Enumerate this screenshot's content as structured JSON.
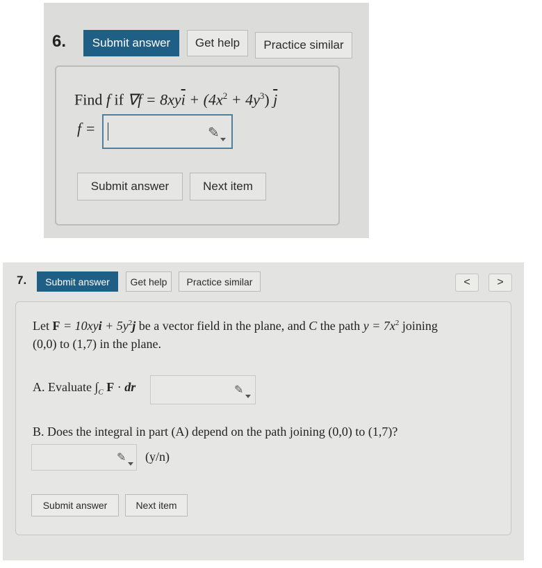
{
  "q6": {
    "number": "6.",
    "submit_top": "Submit answer",
    "get_help": "Get help",
    "practice_similar": "Practice similar",
    "prompt_find": "Find",
    "prompt_f": "f",
    "prompt_if": "if",
    "prompt_grad": "∇f = 8xy",
    "prompt_i": "i",
    "prompt_plus": "+ (4x",
    "prompt_exp2": "2",
    "prompt_mid": " + 4y",
    "prompt_exp3": "3",
    "prompt_close": ")",
    "prompt_j": "j",
    "answer_label": "f =",
    "answer_value": "",
    "submit_bottom": "Submit answer",
    "next_item": "Next item"
  },
  "q7": {
    "number": "7.",
    "submit_top": "Submit answer",
    "get_help": "Get help",
    "practice_similar": "Practice similar",
    "prev_label": "<",
    "next_label": ">",
    "let": "Let",
    "F": "F",
    "eq": " = 10xy",
    "i": "i",
    "plus": " + 5y",
    "exp2": "2",
    "j": "j",
    "desc1": " be a vector field in the plane, and ",
    "C": "C",
    "desc2": " the path ",
    "path_y": "y",
    "path_eq": " = 7x",
    "path_exp": "2",
    "desc3": " joining",
    "line2": "(0,0) to (1,7) in the plane.",
    "partA_prefix": "A. Evaluate",
    "partA_int": "∫",
    "partA_sub": "C",
    "partA_F": "F",
    "partA_dot": "·",
    "partA_dr": "dr",
    "partA_value": "",
    "partB": "B. Does the integral in part (A) depend on the path joining (0,0) to (1,7)?",
    "partB_value": "",
    "yn": "(y/n)",
    "submit_bottom": "Submit answer",
    "next_item": "Next item"
  }
}
